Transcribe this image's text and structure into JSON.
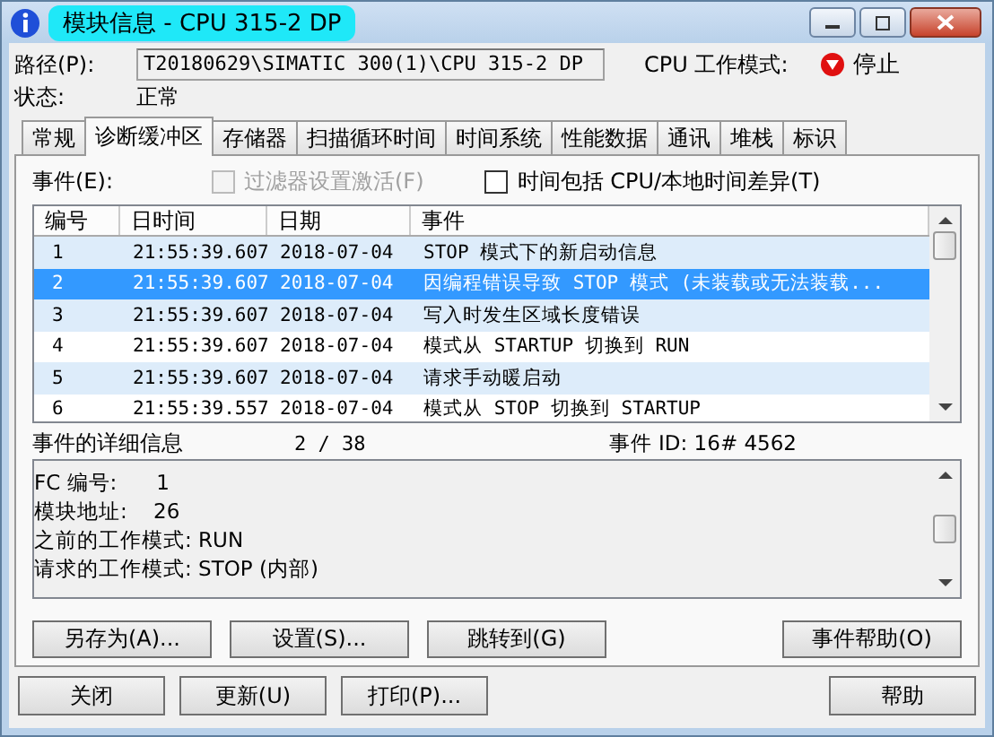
{
  "window": {
    "title": "模块信息 - CPU 315-2 DP"
  },
  "path": {
    "label": "路径(P):",
    "value": "T20180629\\SIMATIC 300(1)\\CPU 315-2 DP"
  },
  "cpu_mode": {
    "label": "CPU 工作模式:",
    "value": "停止"
  },
  "status": {
    "label": "状态:",
    "value": "正常"
  },
  "tabs": [
    {
      "label": "常规",
      "selected": false
    },
    {
      "label": "诊断缓冲区",
      "selected": true
    },
    {
      "label": "存储器",
      "selected": false
    },
    {
      "label": "扫描循环时间",
      "selected": false
    },
    {
      "label": "时间系统",
      "selected": false
    },
    {
      "label": "性能数据",
      "selected": false
    },
    {
      "label": "通讯",
      "selected": false
    },
    {
      "label": "堆栈",
      "selected": false
    },
    {
      "label": "标识",
      "selected": false
    }
  ],
  "events": {
    "label": "事件(E):",
    "checkboxes": [
      {
        "label": "过滤器设置激活(F)",
        "checked": false,
        "disabled": true
      },
      {
        "label": "时间包括 CPU/本地时间差异(T)",
        "checked": false,
        "disabled": false
      }
    ],
    "columns": [
      "编号",
      "日时间",
      "日期",
      "事件"
    ],
    "rows": [
      {
        "cells": [
          "1",
          "21:55:39.607",
          "2018-07-04",
          "STOP 模式下的新启动信息"
        ],
        "selected": false
      },
      {
        "cells": [
          "2",
          "21:55:39.607",
          "2018-07-04",
          "因编程错误导致 STOP 模式 (未装载或无法装载..."
        ],
        "selected": true
      },
      {
        "cells": [
          "3",
          "21:55:39.607",
          "2018-07-04",
          "写入时发生区域长度错误"
        ],
        "selected": false
      },
      {
        "cells": [
          "4",
          "21:55:39.607",
          "2018-07-04",
          "模式从 STARTUP 切换到 RUN"
        ],
        "selected": false
      },
      {
        "cells": [
          "5",
          "21:55:39.607",
          "2018-07-04",
          "请求手动暖启动"
        ],
        "selected": false
      },
      {
        "cells": [
          "6",
          "21:55:39.557",
          "2018-07-04",
          "模式从 STOP 切换到 STARTUP"
        ],
        "selected": false
      }
    ]
  },
  "details": {
    "label": "事件的详细信息",
    "counter": "2 / 38",
    "event_id": "事件 ID: 16# 4562",
    "lines": [
      "FC 编号:      1",
      "模块地址:    26",
      "之前的工作模式: RUN",
      "请求的工作模式: STOP (内部)"
    ]
  },
  "panel_buttons": [
    "另存为(A)...",
    "设置(S)...",
    "跳转到(G)",
    "事件帮助(O)"
  ],
  "buttons": [
    "关闭",
    "更新(U)",
    "打印(P)...",
    "帮助"
  ]
}
